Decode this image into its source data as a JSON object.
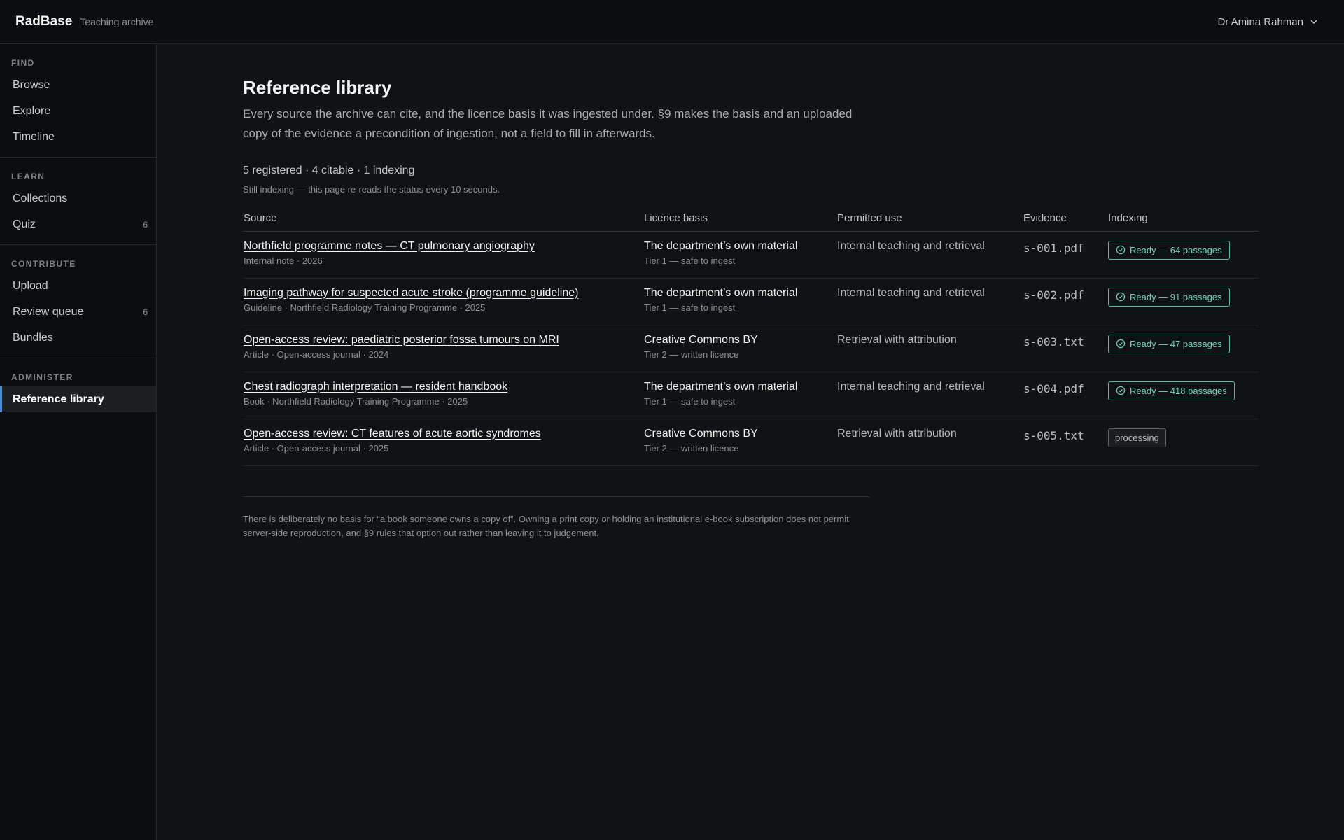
{
  "app": {
    "name": "RadBase",
    "subtitle": "Teaching archive"
  },
  "user": {
    "name": "Dr Amina Rahman"
  },
  "sidebar": {
    "groups": [
      {
        "heading": "FIND",
        "items": [
          {
            "label": "Browse"
          },
          {
            "label": "Explore"
          },
          {
            "label": "Timeline"
          }
        ]
      },
      {
        "heading": "LEARN",
        "items": [
          {
            "label": "Collections"
          },
          {
            "label": "Quiz",
            "count": "6"
          }
        ]
      },
      {
        "heading": "CONTRIBUTE",
        "items": [
          {
            "label": "Upload"
          },
          {
            "label": "Review queue",
            "count": "6"
          },
          {
            "label": "Bundles"
          }
        ]
      },
      {
        "heading": "ADMINISTER",
        "items": [
          {
            "label": "Reference library",
            "active": true
          }
        ]
      }
    ]
  },
  "page": {
    "title": "Reference library",
    "intro": "Every source the archive can cite, and the licence basis it was ingested under. §9 makes the basis and an uploaded copy of the evidence a precondition of ingestion, not a field to fill in afterwards.",
    "summary": "5 registered · 4 citable · 1 indexing",
    "status_note": "Still indexing — this page re-reads the status every 10 seconds.",
    "footnote": "There is deliberately no basis for “a book someone owns a copy of”. Owning a print copy or holding an institutional e-book subscription does not permit server-side reproduction, and §9 rules that option out rather than leaving it to judgement."
  },
  "table": {
    "headers": {
      "source": "Source",
      "basis": "Licence basis",
      "use": "Permitted use",
      "evidence": "Evidence",
      "indexing": "Indexing"
    },
    "rows": [
      {
        "title": "Northfield programme notes — CT pulmonary angiography",
        "meta": "Internal note · 2026",
        "basis": "The department’s own material",
        "tier": "Tier 1 — safe to ingest",
        "use": "Internal teaching and retrieval",
        "evidence": "s-001.pdf",
        "status": "Ready — 64 passages",
        "status_type": "ready"
      },
      {
        "title": "Imaging pathway for suspected acute stroke (programme guideline)",
        "meta": "Guideline · Northfield Radiology Training Programme · 2025",
        "basis": "The department’s own material",
        "tier": "Tier 1 — safe to ingest",
        "use": "Internal teaching and retrieval",
        "evidence": "s-002.pdf",
        "status": "Ready — 91 passages",
        "status_type": "ready"
      },
      {
        "title": "Open-access review: paediatric posterior fossa tumours on MRI",
        "meta": "Article · Open-access journal · 2024",
        "basis": "Creative Commons BY",
        "tier": "Tier 2 — written licence",
        "use": "Retrieval with attribution",
        "evidence": "s-003.txt",
        "status": "Ready — 47 passages",
        "status_type": "ready"
      },
      {
        "title": "Chest radiograph interpretation — resident handbook",
        "meta": "Book · Northfield Radiology Training Programme · 2025",
        "basis": "The department’s own material",
        "tier": "Tier 1 — safe to ingest",
        "use": "Internal teaching and retrieval",
        "evidence": "s-004.pdf",
        "status": "Ready — 418 passages",
        "status_type": "ready"
      },
      {
        "title": "Open-access review: CT features of acute aortic syndromes",
        "meta": "Article · Open-access journal · 2025",
        "basis": "Creative Commons BY",
        "tier": "Tier 2 — written licence",
        "use": "Retrieval with attribution",
        "evidence": "s-005.txt",
        "status": "processing",
        "status_type": "processing"
      }
    ]
  },
  "colors": {
    "accent": "#4a90d9",
    "ready": "#6fd3b5",
    "background": "#101214"
  }
}
